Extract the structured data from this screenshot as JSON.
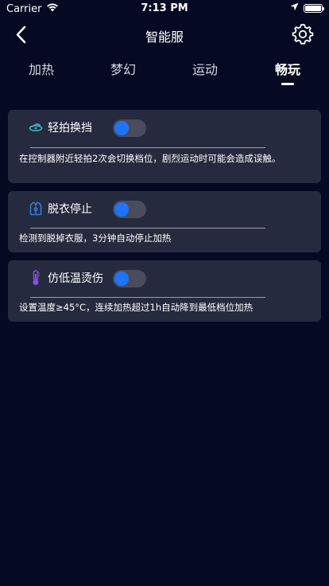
{
  "status_bar": {
    "carrier": "Carrier",
    "time": "7:13 PM"
  },
  "nav": {
    "title": "智能服",
    "back_icon": "chevron-left-icon",
    "settings_icon": "gear-icon"
  },
  "tabs": [
    {
      "label": "加热",
      "active": false
    },
    {
      "label": "梦幻",
      "active": false
    },
    {
      "label": "运动",
      "active": false
    },
    {
      "label": "畅玩",
      "active": true
    }
  ],
  "cards": [
    {
      "title": "轻拍换挡",
      "icon": "tap-hand-icon",
      "icon_color": "#3fb0c8",
      "toggle_on": true,
      "description": "在控制器附近轻拍2次会切换档位，剧烈运动时可能会造成误触。"
    },
    {
      "title": "脱衣停止",
      "icon": "jacket-icon",
      "icon_color": "#3a7bd5",
      "toggle_on": true,
      "description": "检测到脱掉衣服，3分钟自动停止加热"
    },
    {
      "title": "仿低温烫伤",
      "icon": "thermometer-icon",
      "icon_color": "#8a4ee0",
      "toggle_on": true,
      "description": "设置温度≥45°C，连续加热超过1h自动降到最低档位加热"
    }
  ],
  "colors": {
    "background": "#050a22",
    "card": "#262a3e",
    "accent": "#1e73ff"
  }
}
